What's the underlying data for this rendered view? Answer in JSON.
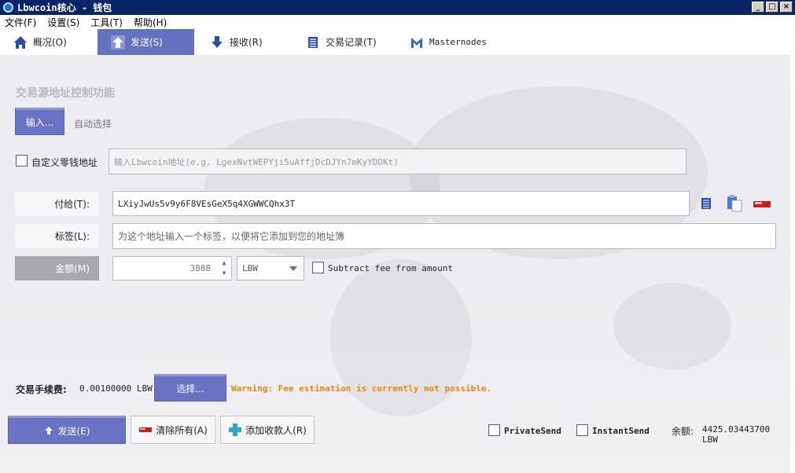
{
  "window": {
    "title": "Lbwcoin核心 - 钱包"
  },
  "menu": {
    "items": [
      "文件(F)",
      "设置(S)",
      "工具(T)",
      "帮助(H)"
    ]
  },
  "tabs": [
    {
      "label": "概况(O)",
      "icon": "home-icon"
    },
    {
      "label": "发送(S)",
      "icon": "send-icon",
      "active": true
    },
    {
      "label": "接收(R)",
      "icon": "receive-icon"
    },
    {
      "label": "交易记录(T)",
      "icon": "transactions-icon"
    },
    {
      "label": "Masternodes",
      "icon": "masternodes-icon"
    }
  ],
  "coin_control": {
    "title": "交易源地址控制功能",
    "inputs_button": "输入...",
    "auto_select": "自动选择",
    "custom_change_label": "自定义零钱地址",
    "change_placeholder": "输入Lbwcoin地址(e.g. LgexNvtWEPYji5uAffjDcDJYn7mKyYDDKt)"
  },
  "recipient": {
    "pay_to_label": "付给(T):",
    "pay_to_value": "LXiyJwUs5v9y6F8VEsGeX5q4XGWWCQhx3T",
    "label_label": "标签(L):",
    "label_placeholder": "为这个地址输入一个标签，以便将它添加到您的地址簿",
    "amount_label": "金额(M)",
    "amount_value": "3888",
    "unit": "LBW",
    "subtract_fee": "Subtract fee from amount"
  },
  "fee": {
    "label": "交易手续费:",
    "value": "0.00100000 LBW",
    "choose_button": "选择...",
    "warning": "Warning: Fee estimation is currently not possible."
  },
  "footer": {
    "send_button": "发送(E)",
    "clear_button": "清除所有(A)",
    "add_recipient_button": "添加收款人(R)",
    "private_send": "PrivateSend",
    "instant_send": "InstantSend",
    "balance_label": "余额:",
    "balance_value": "4425.03443700 LBW"
  },
  "colors": {
    "accent": "#6a72c4",
    "title_bar": "#0a246a",
    "warning": "#e8870a"
  }
}
